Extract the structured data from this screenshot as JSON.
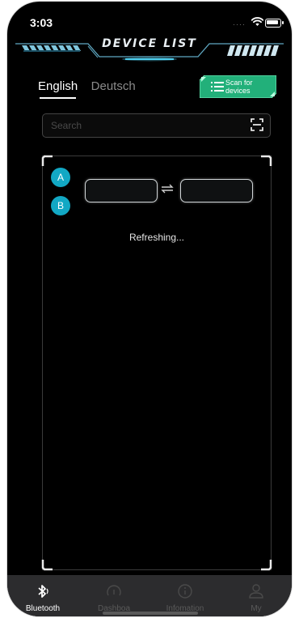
{
  "status_bar": {
    "time": "3:03"
  },
  "header": {
    "title": "DEVICE LIST"
  },
  "language_tabs": [
    {
      "label": "English",
      "active": true
    },
    {
      "label": "Deutsch",
      "active": false
    }
  ],
  "scan_button": {
    "label_line1": "Scan for",
    "label_line2": "devices"
  },
  "search": {
    "placeholder": "Search",
    "value": ""
  },
  "panel": {
    "badges": [
      "A",
      "B"
    ],
    "status_text": "Refreshing..."
  },
  "tabbar": {
    "items": [
      {
        "label": "Bluetooth",
        "icon": "bluetooth-icon",
        "active": true
      },
      {
        "label": "Dashboa",
        "icon": "speedometer-icon",
        "active": false
      },
      {
        "label": "Infomation",
        "icon": "info-icon",
        "active": false
      },
      {
        "label": "My",
        "icon": "person-icon",
        "active": false
      }
    ]
  },
  "colors": {
    "background": "#000000",
    "accent_teal": "#12a8c4",
    "scan_button_green": "#22b07a",
    "tabbar_bg": "#2c2c2e",
    "header_glow": "#4fd0f0"
  }
}
